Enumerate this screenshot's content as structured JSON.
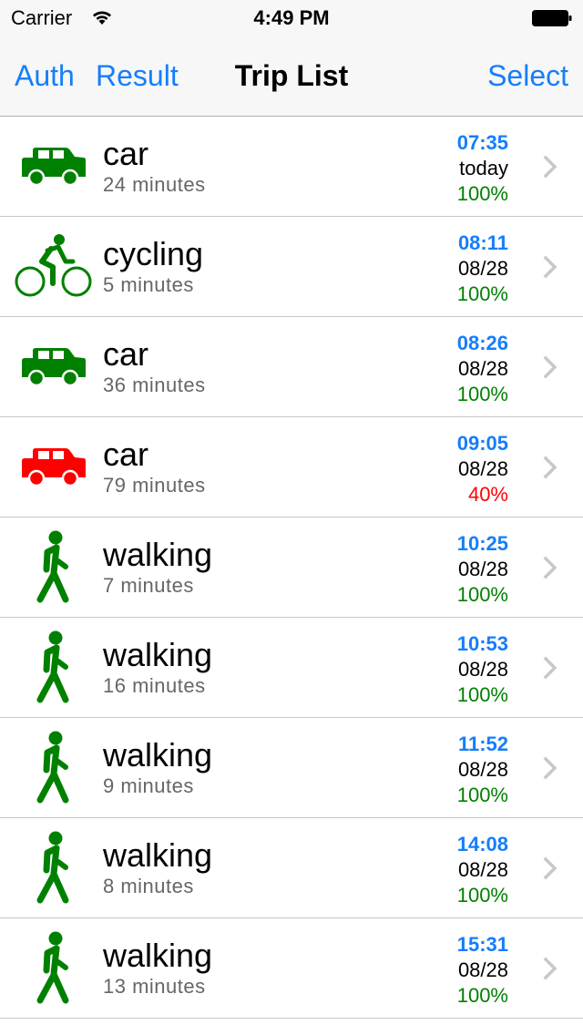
{
  "status_bar": {
    "carrier": "Carrier",
    "time": "4:49 PM",
    "wifi_icon": "wifi-icon",
    "battery_icon": "battery-full-icon"
  },
  "nav": {
    "auth_label": "Auth",
    "result_label": "Result",
    "title": "Trip List",
    "select_label": "Select",
    "accent_color": "#157efb"
  },
  "colors": {
    "ok": "#008000",
    "warn": "#ff0000",
    "time": "#157efb"
  },
  "trips": [
    {
      "mode": "car",
      "icon": "car-icon",
      "status": "ok",
      "duration": "24 minutes",
      "time": "07:35",
      "date": "today",
      "confidence": "100%"
    },
    {
      "mode": "cycling",
      "icon": "bicycle-icon",
      "status": "ok",
      "duration": "5 minutes",
      "time": "08:11",
      "date": "08/28",
      "confidence": "100%"
    },
    {
      "mode": "car",
      "icon": "car-icon",
      "status": "ok",
      "duration": "36 minutes",
      "time": "08:26",
      "date": "08/28",
      "confidence": "100%"
    },
    {
      "mode": "car",
      "icon": "car-icon",
      "status": "warn",
      "duration": "79 minutes",
      "time": "09:05",
      "date": "08/28",
      "confidence": "40%"
    },
    {
      "mode": "walking",
      "icon": "walking-icon",
      "status": "ok",
      "duration": "7 minutes",
      "time": "10:25",
      "date": "08/28",
      "confidence": "100%"
    },
    {
      "mode": "walking",
      "icon": "walking-icon",
      "status": "ok",
      "duration": "16 minutes",
      "time": "10:53",
      "date": "08/28",
      "confidence": "100%"
    },
    {
      "mode": "walking",
      "icon": "walking-icon",
      "status": "ok",
      "duration": "9 minutes",
      "time": "11:52",
      "date": "08/28",
      "confidence": "100%"
    },
    {
      "mode": "walking",
      "icon": "walking-icon",
      "status": "ok",
      "duration": "8 minutes",
      "time": "14:08",
      "date": "08/28",
      "confidence": "100%"
    },
    {
      "mode": "walking",
      "icon": "walking-icon",
      "status": "ok",
      "duration": "13 minutes",
      "time": "15:31",
      "date": "08/28",
      "confidence": "100%"
    }
  ]
}
